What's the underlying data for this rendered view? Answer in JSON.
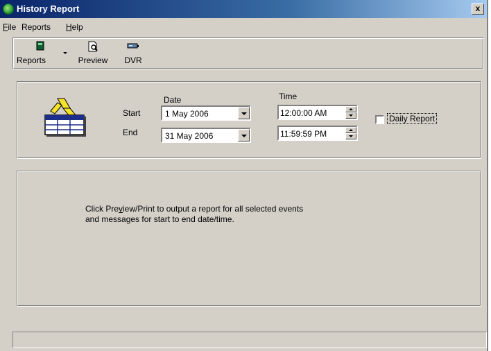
{
  "window": {
    "title": "History Report",
    "close_label": "x"
  },
  "menubar": {
    "file": {
      "prefix": "",
      "accel": "F",
      "rest": "ile"
    },
    "reports": {
      "label": "Reports"
    },
    "help": {
      "prefix": "",
      "accel": "H",
      "rest": "elp"
    }
  },
  "toolbar": {
    "reports_label": "Reports",
    "preview_label": "Preview",
    "dvr_label": "DVR"
  },
  "filter": {
    "date_header": "Date",
    "time_header": "Time",
    "start_label": "Start",
    "end_label": "End",
    "start_date": "1  May 2006",
    "end_date": "31 May 2006",
    "start_time": "12:00:00 AM",
    "end_time": "11:59:59 PM",
    "daily_report_label": "Daily Report",
    "daily_report_checked": false
  },
  "message": {
    "line1_a": "Click Pre",
    "line1_accel": "v",
    "line1_b": "iew/Print to output a report for all selected events",
    "line2": "and messages for start to end date/time."
  },
  "status": {
    "text": ""
  }
}
